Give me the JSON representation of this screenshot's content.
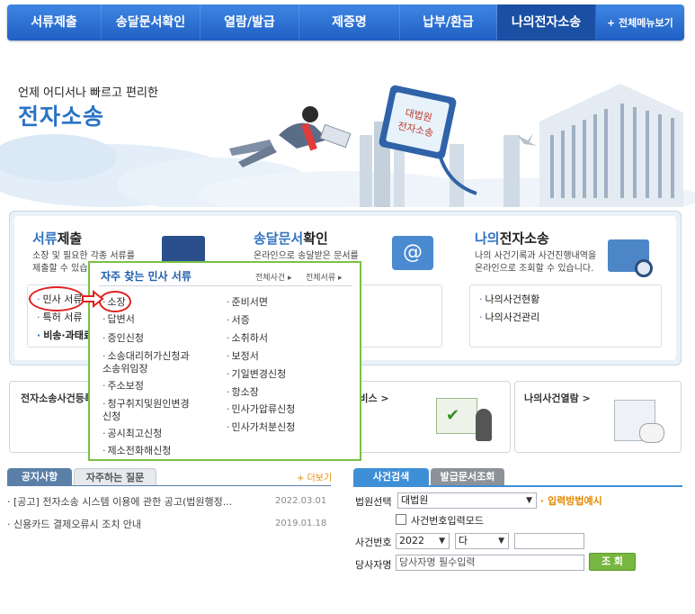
{
  "nav": {
    "items": [
      "서류제출",
      "송달문서확인",
      "열람/발급",
      "제증명",
      "납부/환급",
      "나의전자소송"
    ],
    "all_menu": "+ 전체메뉴보기"
  },
  "hero": {
    "subtitle": "언제 어디서나 빠르고 편리한",
    "title": "전자소송",
    "monitor_text": "대법원\n전자소송"
  },
  "services": [
    {
      "title_hl": "서류",
      "title_rest": "제출",
      "desc": [
        "소장 및 필요한 각종 서류를",
        "제출할 수 있습니"
      ],
      "links": [
        "민사 서류",
        "특허 서류",
        "비송·과태료"
      ]
    },
    {
      "title_hl": "송달문서",
      "title_rest": "확인",
      "desc": [
        "온라인으로 송달받은 문서를",
        ""
      ],
      "links": []
    },
    {
      "title_hl": "나의",
      "title_rest": "전자소송",
      "desc": [
        "나의 사건기록과 사건진행내역을",
        "온라인으로 조회할 수 있습니다."
      ],
      "links": [
        "나의사건현황",
        "나의사건관리"
      ]
    }
  ],
  "banners": {
    "left": "전자소송사건등록",
    "middle": "알림서비스 >",
    "right": "나의사건열람 >"
  },
  "popup": {
    "title": "자주 찾는 민사 서류",
    "link_all_case": "전체사건 ▸",
    "link_all_docs": "전체서류 ▸",
    "left_items": [
      "소장",
      "답변서",
      "증인신청",
      "소송대리허가신청과\n소송위임장",
      "주소보정",
      "청구취지및원인변경\n신청",
      "공시최고신청",
      "제소전화해신청"
    ],
    "right_items": [
      "준비서면",
      "서증",
      "소취하서",
      "보정서",
      "기일변경신청",
      "항소장",
      "민사가압류신청",
      "민사가처분신청"
    ]
  },
  "notice": {
    "tab_active": "공지사항",
    "tab_inactive": "자주하는 질문",
    "more": "+ 더보기",
    "rows": [
      {
        "text": "[공고] 전자소송 시스템 이용에 관한 공고(법원행정...",
        "date": "2022.03.01"
      },
      {
        "text": "신용카드 결제오류시 조치 안내",
        "date": "2019.01.18"
      }
    ]
  },
  "search": {
    "tab_active": "사건검색",
    "tab_inactive": "발급문서조회",
    "court_label": "법원선택",
    "court_value": "대법원",
    "input_method": "입력방법예시",
    "checkbox_label": "사건번호입력모드",
    "case_no_label": "사건번호",
    "year_value": "2022",
    "type_value": "다",
    "party_label": "당사자명",
    "party_placeholder": "당사자명 필수입력",
    "submit": "조 회"
  },
  "colors": {
    "nav_blue": "#2a6fd4",
    "popup_border": "#7ac143",
    "highlight_red": "#e02020",
    "submit_green": "#77b640",
    "input_method_orange": "#e38a00"
  }
}
